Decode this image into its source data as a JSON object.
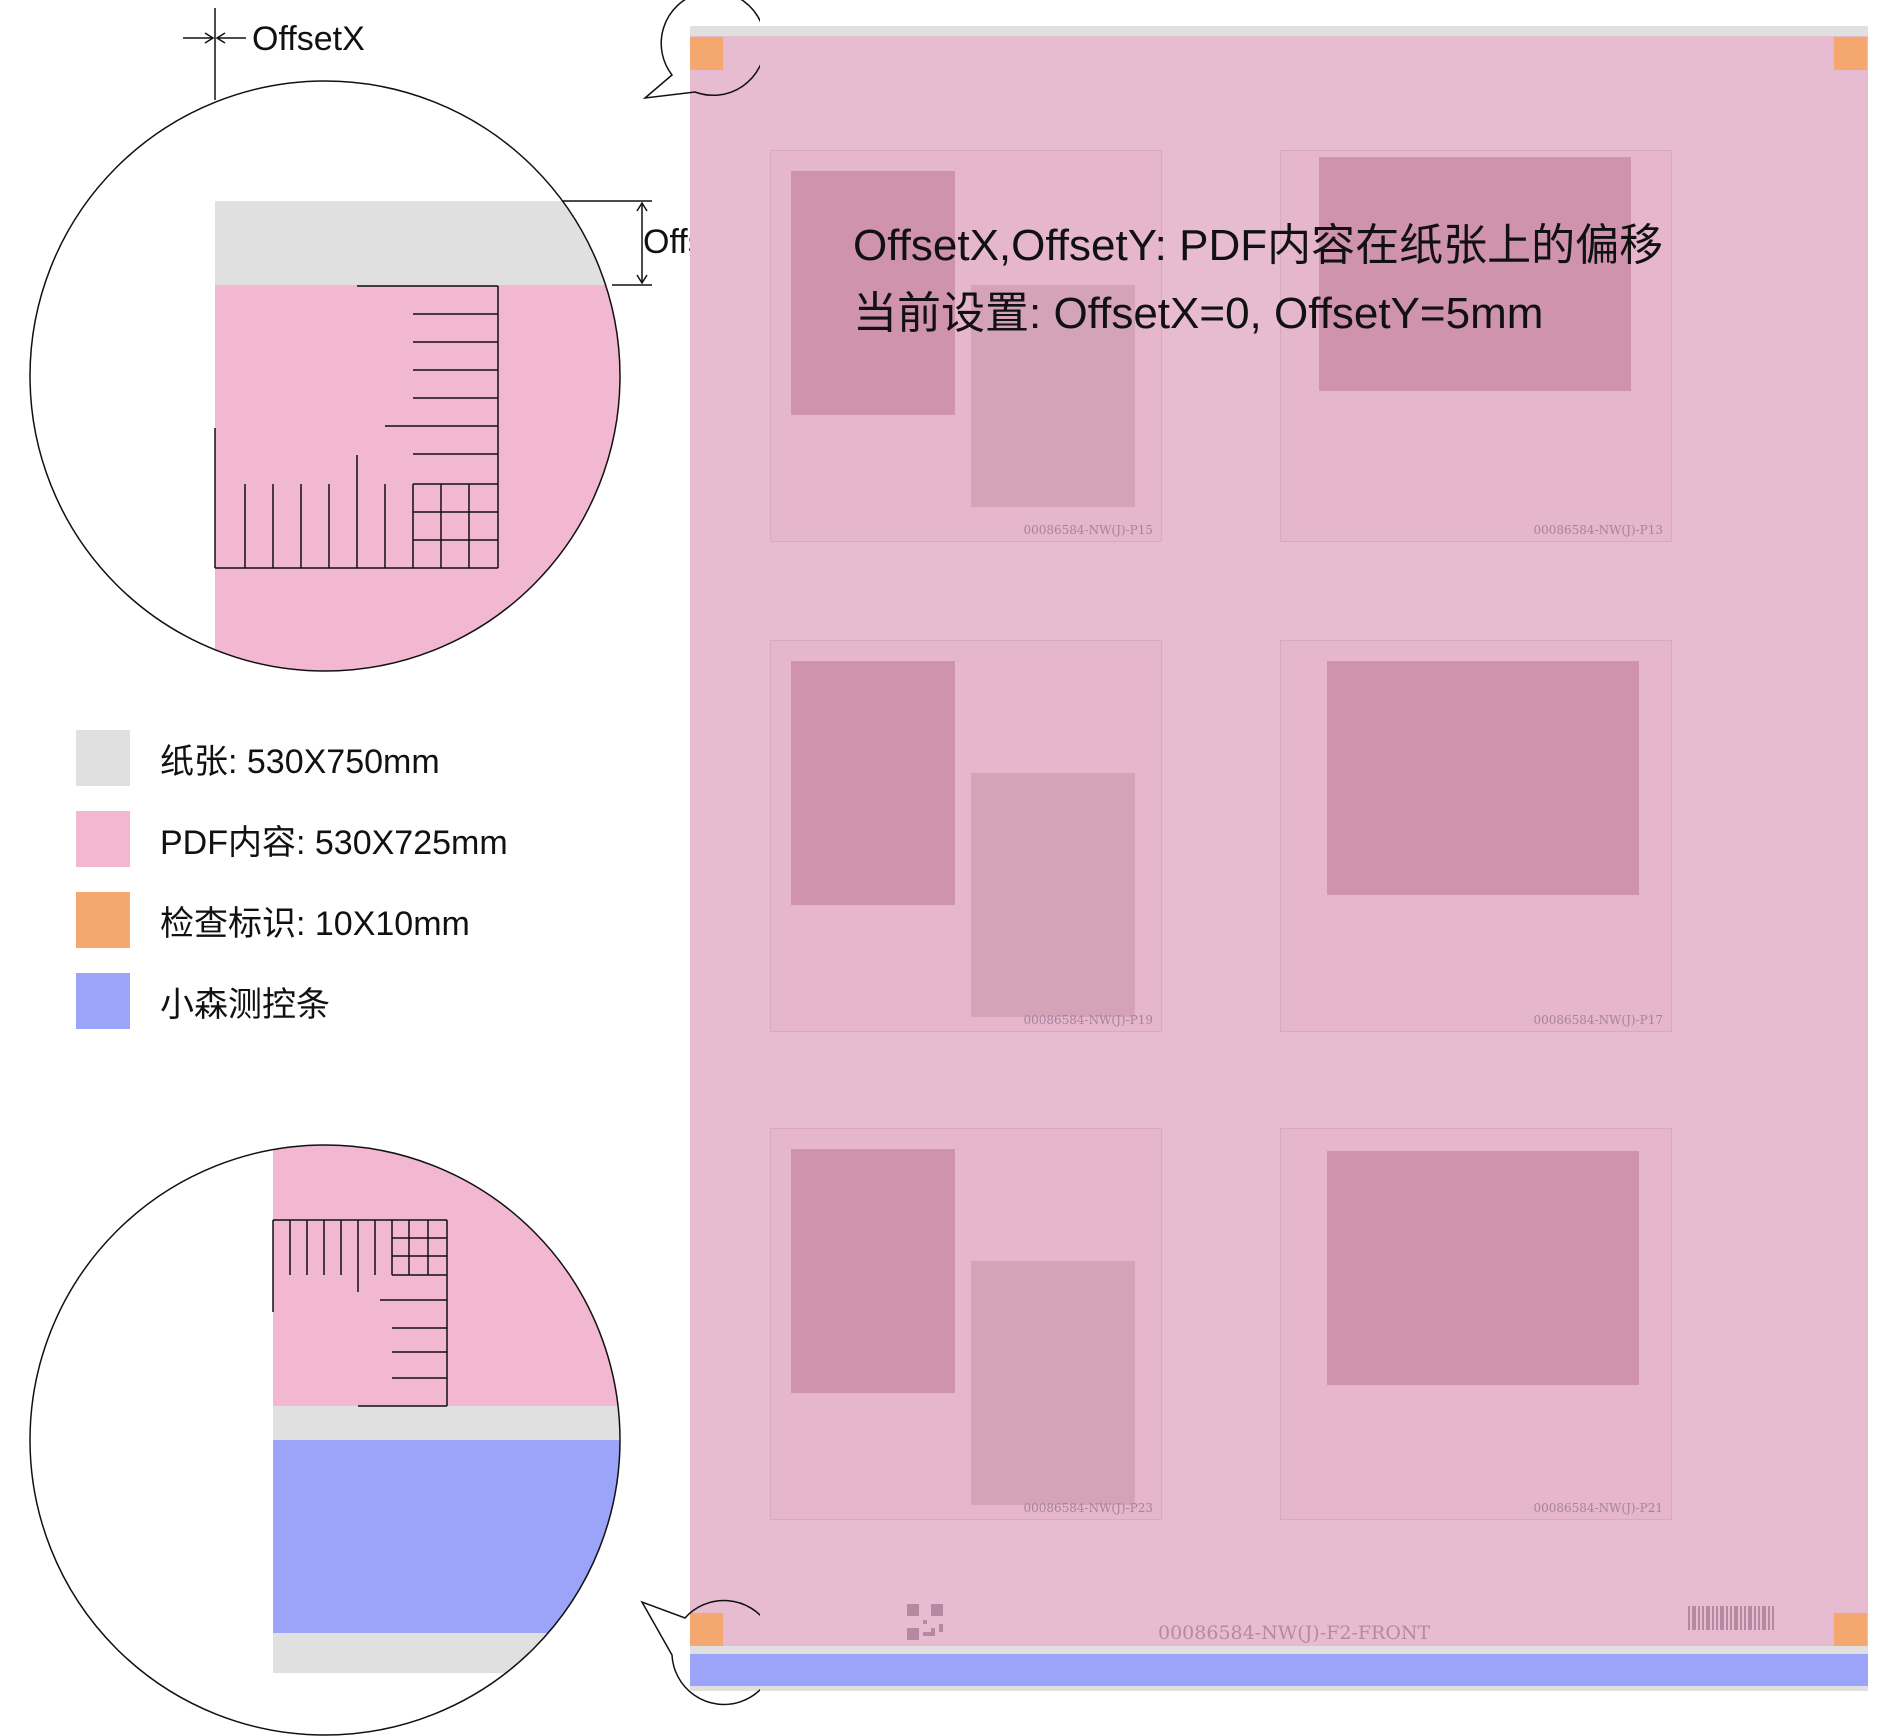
{
  "diagram": {
    "heading_line1": "OffsetX,OffsetY: PDF内容在纸张上的偏移",
    "heading_line2": "当前设置: OffsetX=0, OffsetY=5mm",
    "offset_x_label": "OffsetX",
    "offset_y_label": "OffsetY"
  },
  "legend": {
    "items": [
      {
        "label": "纸张: 530X750mm",
        "color": "#e0e0e0"
      },
      {
        "label": "PDF内容: 530X725mm",
        "color": "#f2b7d1"
      },
      {
        "label": "检查标识: 10X10mm",
        "color": "#f4a86f"
      },
      {
        "label": "小森测控条",
        "color": "#9ba4f9"
      }
    ]
  },
  "sheet": {
    "footer_code": "00086584-NW(J)-F2-FRONT",
    "cell_codes": [
      "00086584-NW(J)-P15",
      "00086584-NW(J)-P13",
      "00086584-NW(J)-P19",
      "00086584-NW(J)-P17",
      "00086584-NW(J)-P23",
      "00086584-NW(J)-P21"
    ]
  }
}
